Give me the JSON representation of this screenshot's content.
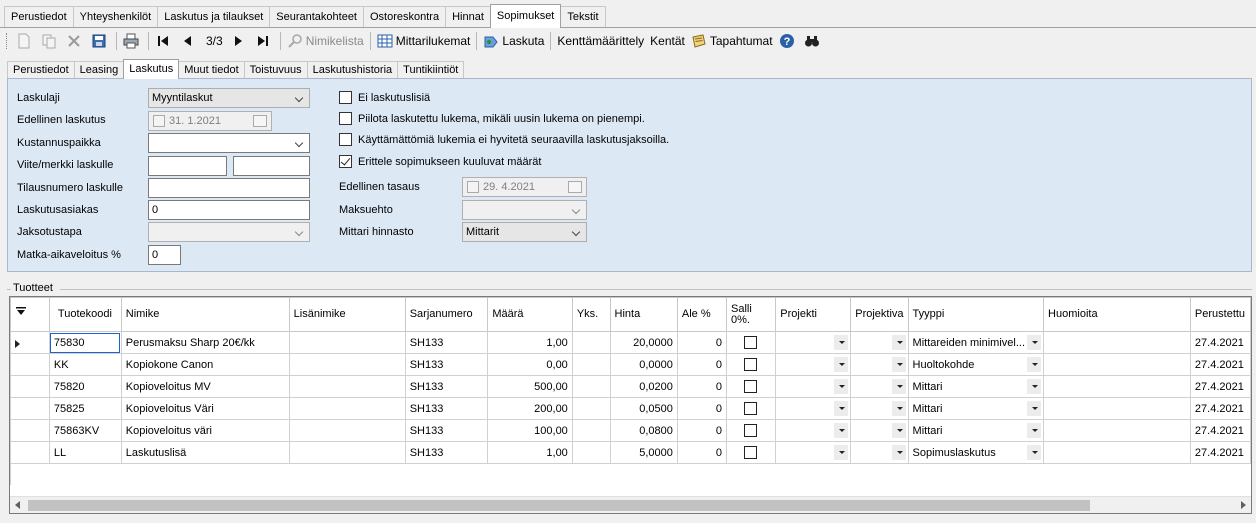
{
  "top_tabs": [
    "Perustiedot",
    "Yhteyshenkilöt",
    "Laskutus ja tilaukset",
    "Seurantakohteet",
    "Ostoreskontra",
    "Hinnat",
    "Sopimukset",
    "Tekstit"
  ],
  "active_top_tab": "Sopimukset",
  "toolbar": {
    "pager": "3/3",
    "nimikelista": "Nimikelista",
    "mittarilukemat": "Mittarilukemat",
    "laskuta": "Laskuta",
    "kenttamaarittely": "Kenttämäärittely",
    "kentat": "Kentät",
    "tapahtumat": "Tapahtumat"
  },
  "sub_tabs": [
    "Perustiedot",
    "Leasing",
    "Laskutus",
    "Muut tiedot",
    "Toistuvuus",
    "Laskutushistoria",
    "Tuntikiintiöt"
  ],
  "active_sub_tab": "Laskutus",
  "form": {
    "laskulaji_label": "Laskulaji",
    "laskulaji_value": "Myyntilaskut",
    "edellinen_laskutus_label": "Edellinen laskutus",
    "edellinen_laskutus_value": "31.  1.2021",
    "kustannuspaikka_label": "Kustannuspaikka",
    "viite_label": "Viite/merkki laskulle",
    "tilausnumero_label": "Tilausnumero laskulle",
    "laskutusasiakas_label": "Laskutusasiakas",
    "laskutusasiakas_value": "0",
    "jaksotustapa_label": "Jaksotustapa",
    "matka_label": "Matka-aikaveloitus %",
    "matka_value": "0",
    "cb_ei_laskutuslisia": "Ei laskutuslisiä",
    "cb_piilota": "Piilota laskutettu lukema, mikäli uusin lukema on pienempi.",
    "cb_kayttamattomia": "Käyttämättömiä lukemia ei hyvitetä seuraavilla laskutusjaksoilla.",
    "cb_erittele": "Erittele sopimukseen kuuluvat määrät",
    "edellinen_tasaus_label": "Edellinen tasaus",
    "edellinen_tasaus_value": "29.  4.2021",
    "maksuehto_label": "Maksuehto",
    "mittari_hinnasto_label": "Mittari hinnasto",
    "mittari_hinnasto_value": "Mittarit"
  },
  "products": {
    "title": "Tuotteet",
    "columns": [
      "Tuotekoodi",
      "Nimike",
      "Lisänimike",
      "Sarjanumero",
      "Määrä",
      "Yks.",
      "Hinta",
      "Ale %",
      "Salli 0%.",
      "Projekti",
      "Projektiva",
      "Tyyppi",
      "Huomioita",
      "Perustettu"
    ],
    "rows": [
      {
        "koodi": "75830",
        "nimike": "Perusmaksu Sharp 20€/kk",
        "lisanimike": "",
        "sarja": "SH133",
        "maara": "1,00",
        "yks": "",
        "hinta": "20,0000",
        "ale": "0",
        "tyyppi": "Mittareiden minimivel...",
        "huom": "",
        "perustettu": "27.4.2021"
      },
      {
        "koodi": "KK",
        "nimike": "Kopiokone Canon",
        "lisanimike": "",
        "sarja": "SH133",
        "maara": "0,00",
        "yks": "",
        "hinta": "0,0000",
        "ale": "0",
        "tyyppi": "Huoltokohde",
        "huom": "",
        "perustettu": "27.4.2021"
      },
      {
        "koodi": "75820",
        "nimike": "Kopioveloitus MV",
        "lisanimike": "",
        "sarja": "SH133",
        "maara": "500,00",
        "yks": "",
        "hinta": "0,0200",
        "ale": "0",
        "tyyppi": "Mittari",
        "huom": "",
        "perustettu": "27.4.2021"
      },
      {
        "koodi": "75825",
        "nimike": "Kopioveloitus Väri",
        "lisanimike": "",
        "sarja": "SH133",
        "maara": "200,00",
        "yks": "",
        "hinta": "0,0500",
        "ale": "0",
        "tyyppi": "Mittari",
        "huom": "",
        "perustettu": "27.4.2021"
      },
      {
        "koodi": "75863KV",
        "nimike": "Kopioveloitus väri",
        "lisanimike": "",
        "sarja": "SH133",
        "maara": "100,00",
        "yks": "",
        "hinta": "0,0800",
        "ale": "0",
        "tyyppi": "Mittari",
        "huom": "",
        "perustettu": "27.4.2021"
      },
      {
        "koodi": "LL",
        "nimike": "Laskutuslisä",
        "lisanimike": "",
        "sarja": "SH133",
        "maara": "1,00",
        "yks": "",
        "hinta": "5,0000",
        "ale": "0",
        "tyyppi": "Sopimuslaskutus",
        "huom": "",
        "perustettu": "27.4.2021"
      }
    ]
  }
}
